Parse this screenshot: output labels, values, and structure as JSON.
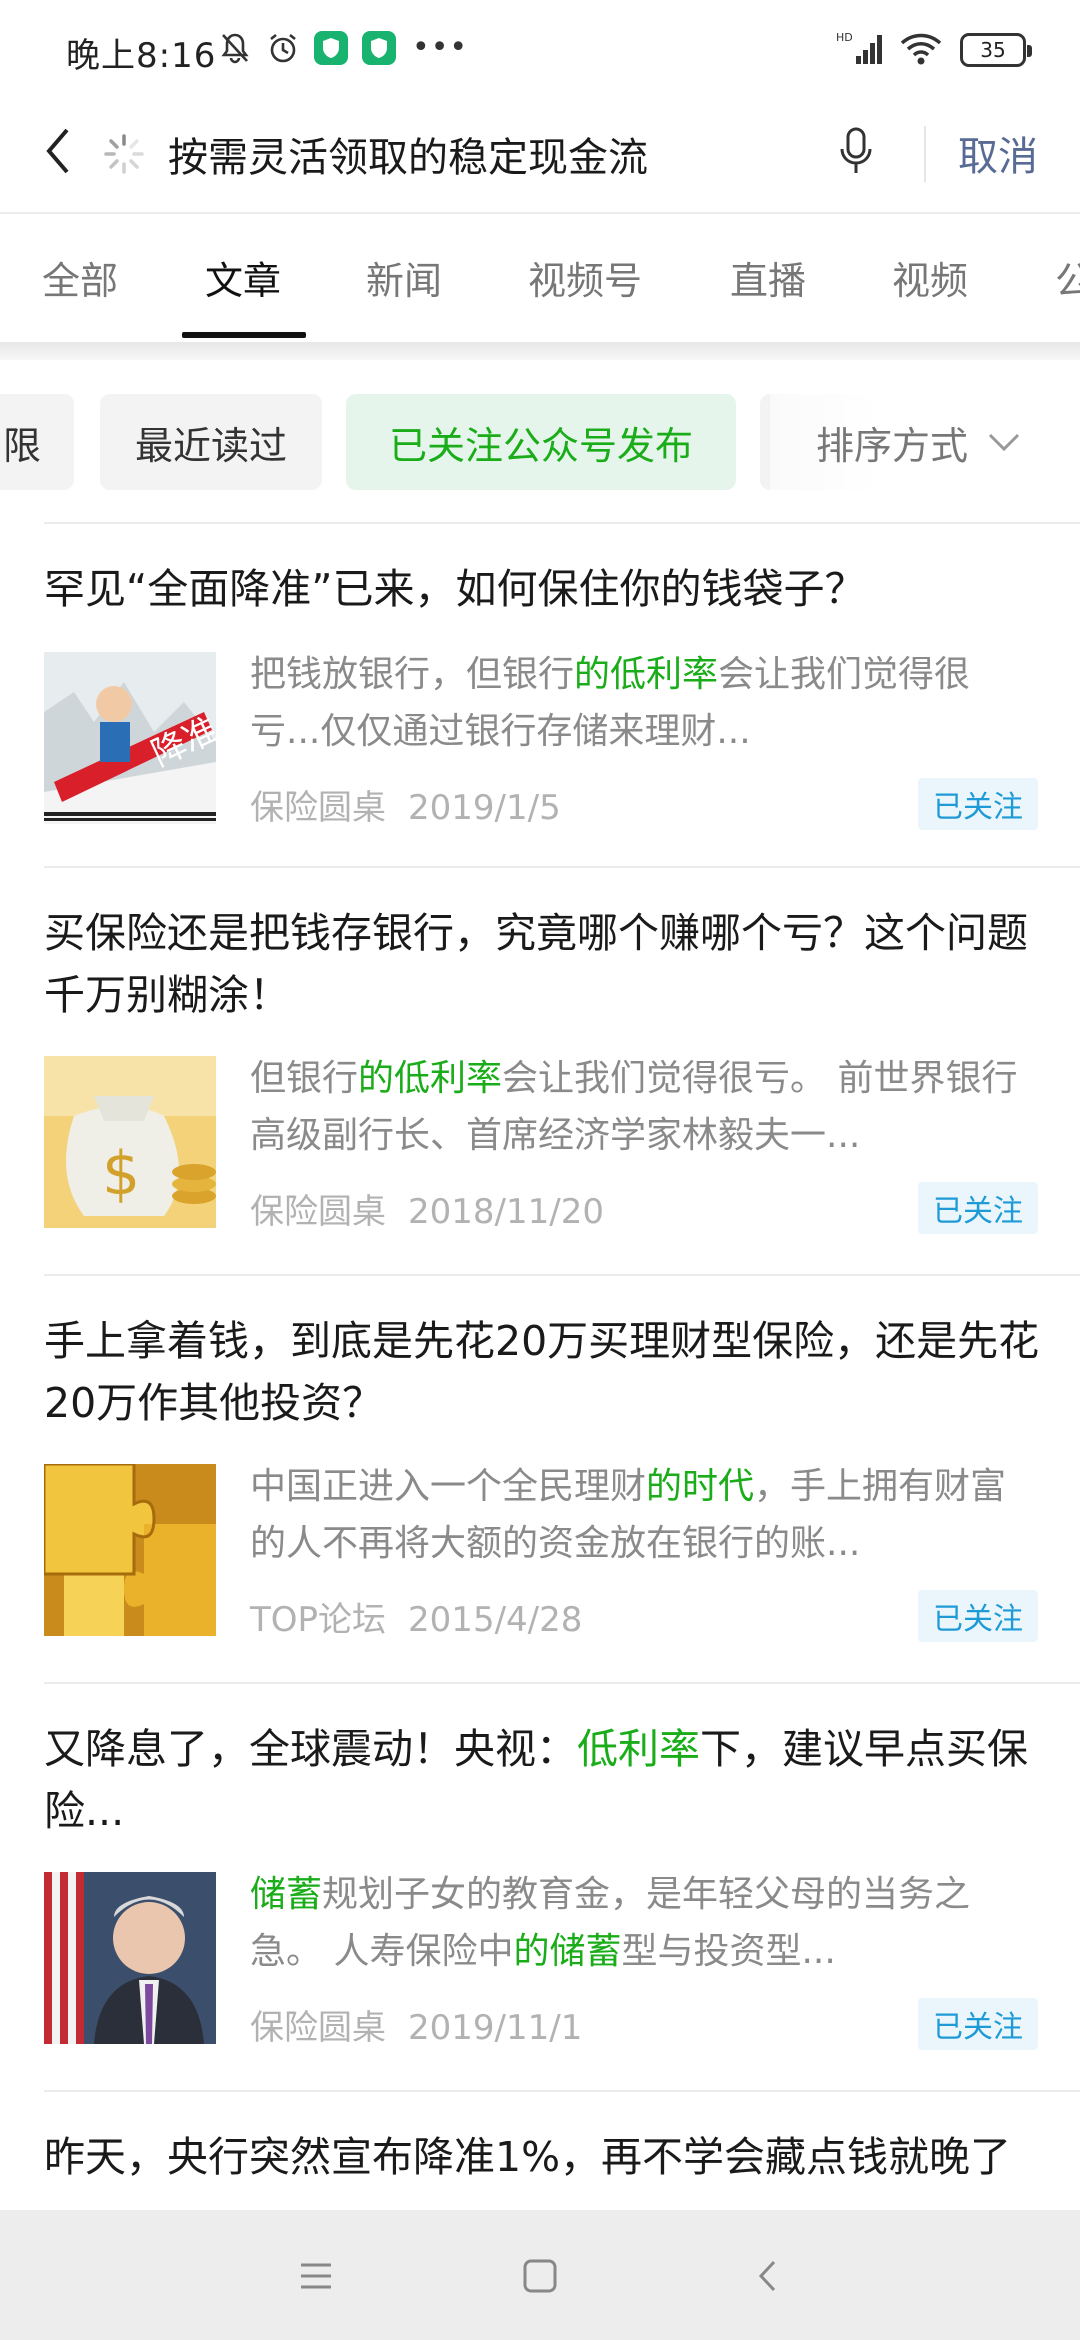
{
  "status_bar": {
    "time": "晚上8:16",
    "battery": "35",
    "network": "HD"
  },
  "search": {
    "query": "按需灵活领取的稳定现金流",
    "cancel_label": "取消"
  },
  "tabs": [
    {
      "label": "全部"
    },
    {
      "label": "文章"
    },
    {
      "label": "新闻"
    },
    {
      "label": "视频号"
    },
    {
      "label": "直播"
    },
    {
      "label": "视频"
    },
    {
      "label": "公"
    }
  ],
  "filters": {
    "chips": [
      {
        "label": "限"
      },
      {
        "label": "最近读过"
      },
      {
        "label": "已关注公众号发布"
      }
    ],
    "sort_label": "排序方式"
  },
  "colors": {
    "accent_green": "#1aad19",
    "followed_blue": "#1e9bd6",
    "cancel_blue": "#576b95"
  },
  "articles": [
    {
      "title": "罕见“全面降准”已来，如何保住你的钱袋子？",
      "desc_parts": [
        "把钱放银行，但银行",
        "的低利率",
        "会让我们觉得很亏...仅仅通过银行存储来理财..."
      ],
      "source": "保险圆桌",
      "date": "2019/1/5",
      "badge": "已关注",
      "thumb_text": "降准"
    },
    {
      "title": "买保险还是把钱存银行，究竟哪个赚哪个亏？这个问题千万别糊涂！",
      "desc_parts": [
        "但银行",
        "的低利率",
        "会让我们觉得很亏。 前世界银行高级副行长、首席经济学家林毅夫一..."
      ],
      "source": "保险圆桌",
      "date": "2018/11/20",
      "badge": "已关注",
      "thumb_text": "$"
    },
    {
      "title": "手上拿着钱，到底是先花20万买理财型保险，还是先花20万作其他投资？",
      "desc_parts": [
        "中国正进入一个全民理财",
        "的时代",
        "，手上拥有财富的人不再将大额的资金放在银行的账..."
      ],
      "source": "TOP论坛",
      "date": "2015/4/28",
      "badge": "已关注",
      "thumb_text": ""
    },
    {
      "title_parts": [
        "又降息了，全球震动！央视：",
        "低利率",
        "下，建议早点买保险..."
      ],
      "desc_parts": [
        "储蓄",
        "规划子女的教育金，是年轻父母的当务之急。 人寿保险中",
        "的储蓄",
        "型与投资型..."
      ],
      "source": "保险圆桌",
      "date": "2019/11/1",
      "badge": "已关注",
      "thumb_text": ""
    },
    {
      "title": "昨天，央行突然宣布降准1%，再不学会藏点钱就",
      "title_cut": "晚了"
    }
  ]
}
